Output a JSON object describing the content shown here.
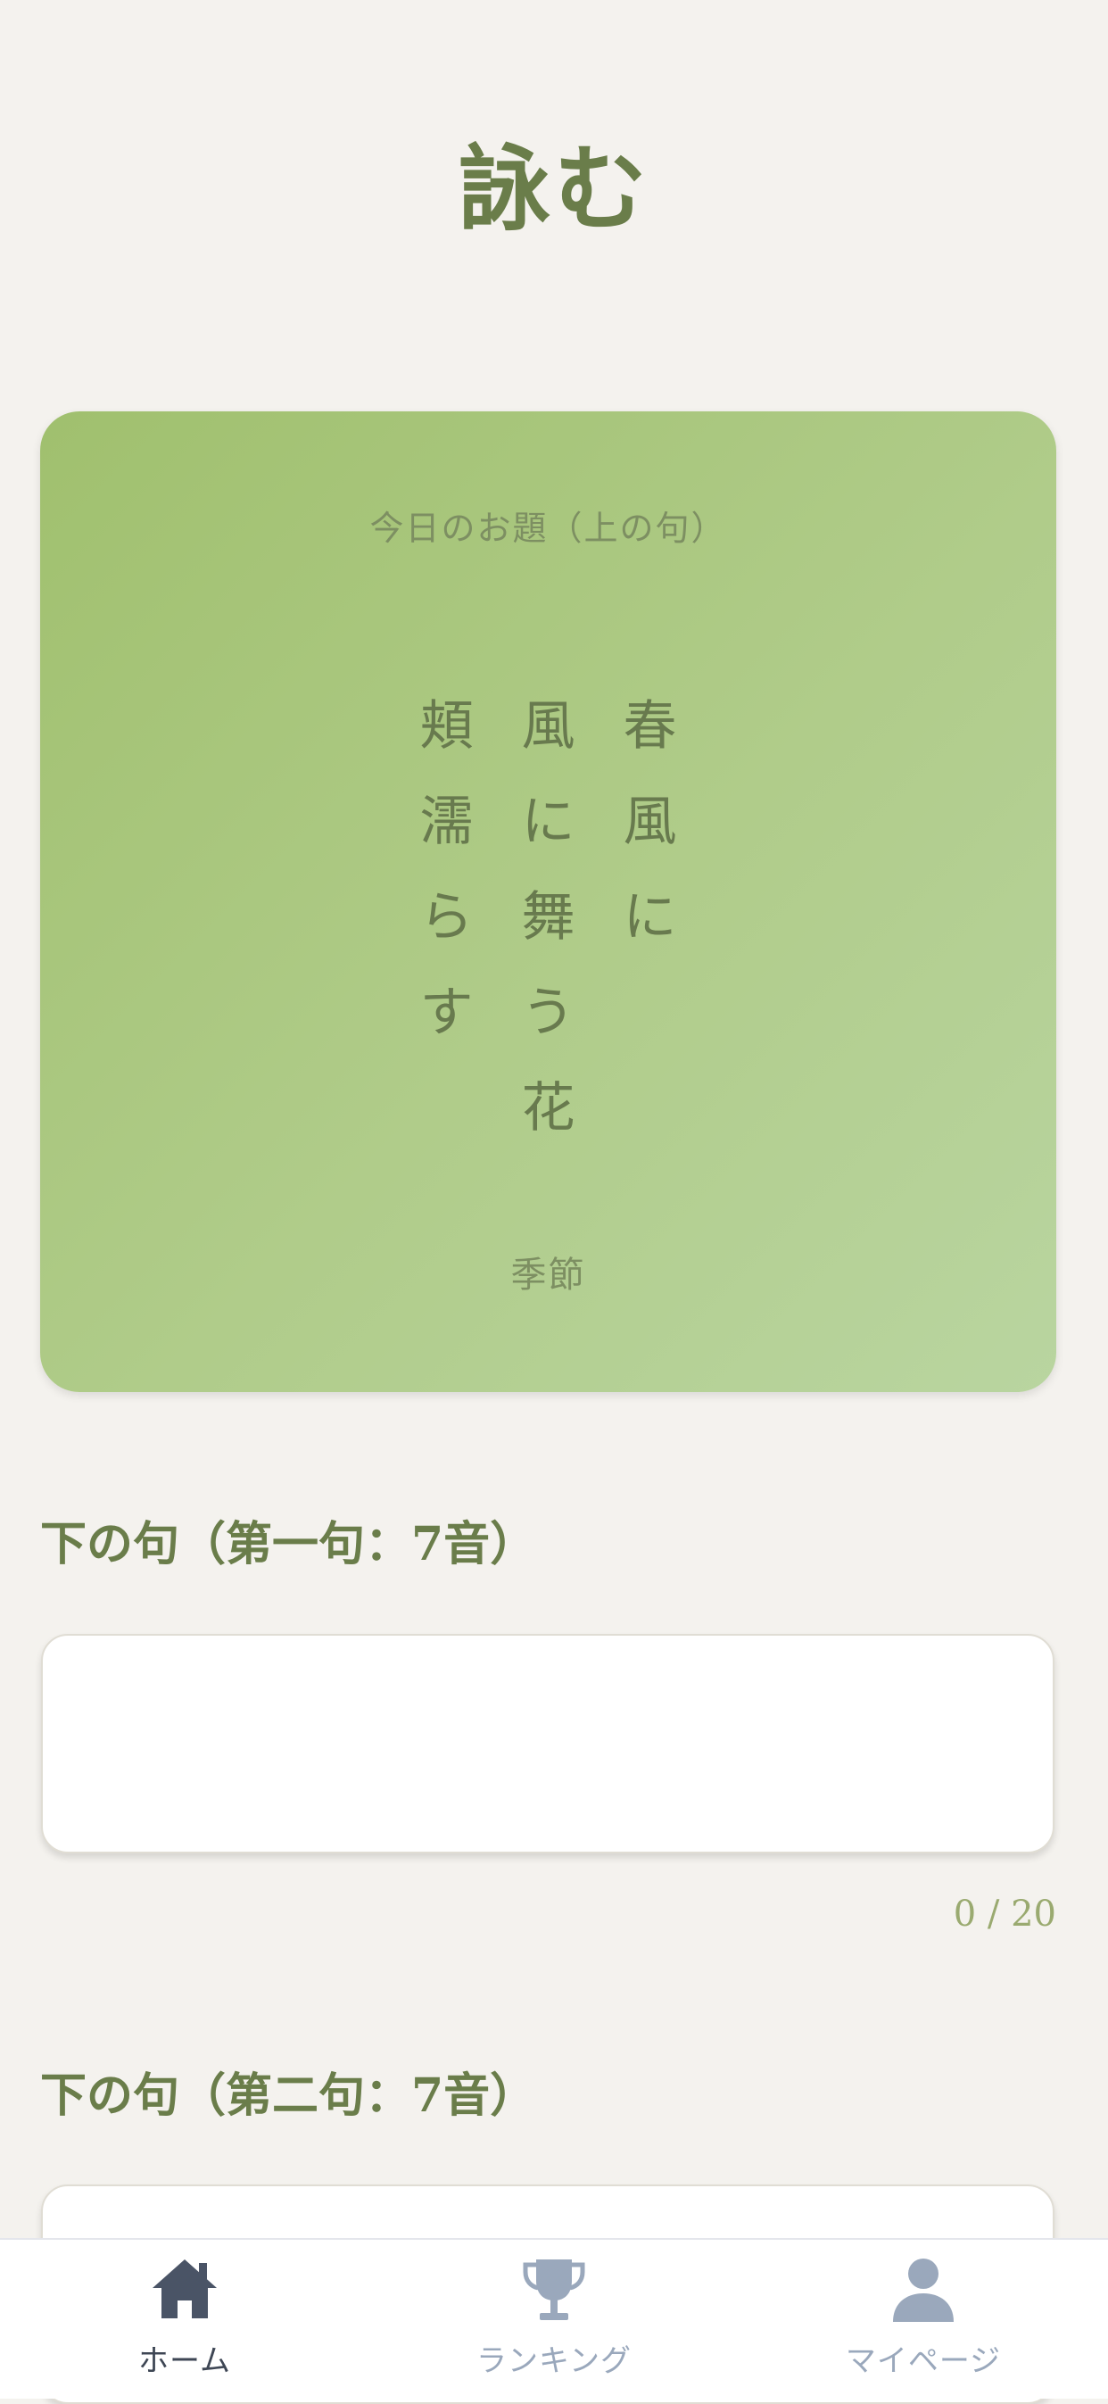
{
  "header": {
    "title": "詠む"
  },
  "theme_card": {
    "label": "今日のお題（上の句）",
    "verse_lines": [
      "春風に",
      "風に舞う花",
      "頬濡らす"
    ],
    "category": "季節"
  },
  "form": {
    "field1": {
      "label": "下の句（第一句：7音）",
      "value": "",
      "counter": "0 / 20"
    },
    "field2": {
      "label": "下の句（第二句：7音）",
      "value": ""
    }
  },
  "bottom_nav": {
    "items": [
      {
        "label": "ホーム",
        "icon": "home-icon",
        "active": true
      },
      {
        "label": "ランキング",
        "icon": "trophy-icon",
        "active": false
      },
      {
        "label": "マイページ",
        "icon": "user-icon",
        "active": false
      }
    ]
  },
  "colors": {
    "background": "#f4f2ee",
    "accent": "#6a7d4a",
    "card_gradient_start": "#a0c06e",
    "card_gradient_end": "#b9d5a0",
    "nav_active": "#3e4654",
    "nav_inactive": "#9aa8bc"
  }
}
